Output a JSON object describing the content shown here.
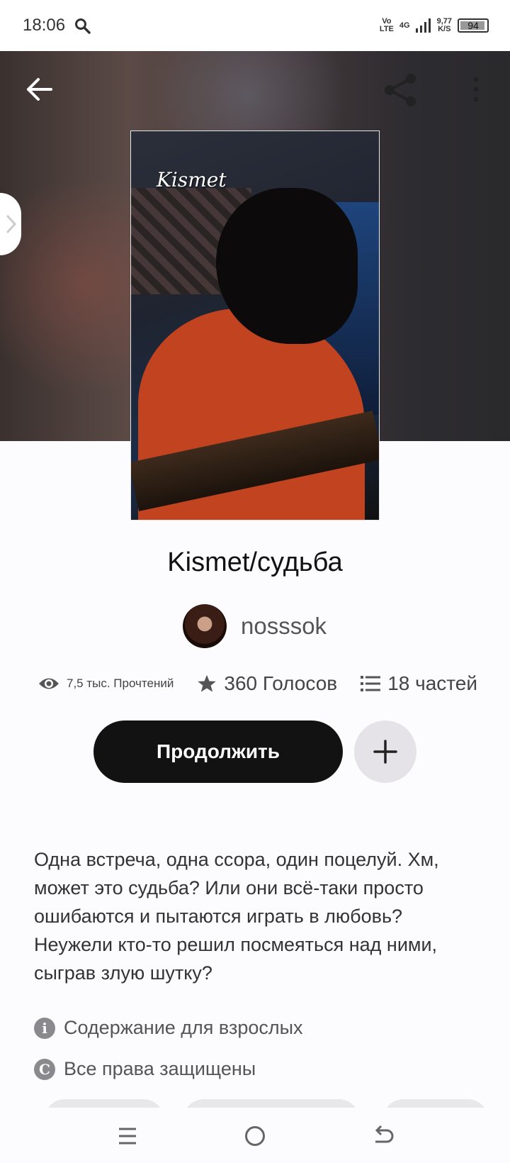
{
  "status_bar": {
    "time": "18:06",
    "network_top": "Vo",
    "network_bottom": "LTE",
    "net_type": "4G",
    "speed_top": "9,77",
    "speed_bottom": "K/S",
    "battery": "94"
  },
  "header": {
    "back_icon": "arrow-left-icon",
    "share_icon": "share-icon",
    "more_icon": "more-vertical-icon"
  },
  "book": {
    "cover_text": "Kismet",
    "title": "Kismet/судьба",
    "author": "nosssok",
    "stats": {
      "reads": "7,5 тыс. Прочтений",
      "votes": "360 Голосов",
      "parts": "18 частей"
    },
    "continue_label": "Продолжить",
    "description": "Одна встреча, одна ссора, один поцелуй. Хм, может это судьба? Или они всё-таки просто ошибаются и пытаются играть в любовь? Неужели кто-то решил посмеяться над ними, сыграв злую шутку?",
    "tags": {
      "mature": "Содержание для взрослых",
      "copyright": "Все права защищены",
      "mature_icon_glyph": "i",
      "copyright_icon_glyph": "C"
    }
  },
  "nav": {
    "menu_icon": "menu-icon",
    "home_icon": "home-circle-icon",
    "back_icon": "back-icon"
  }
}
